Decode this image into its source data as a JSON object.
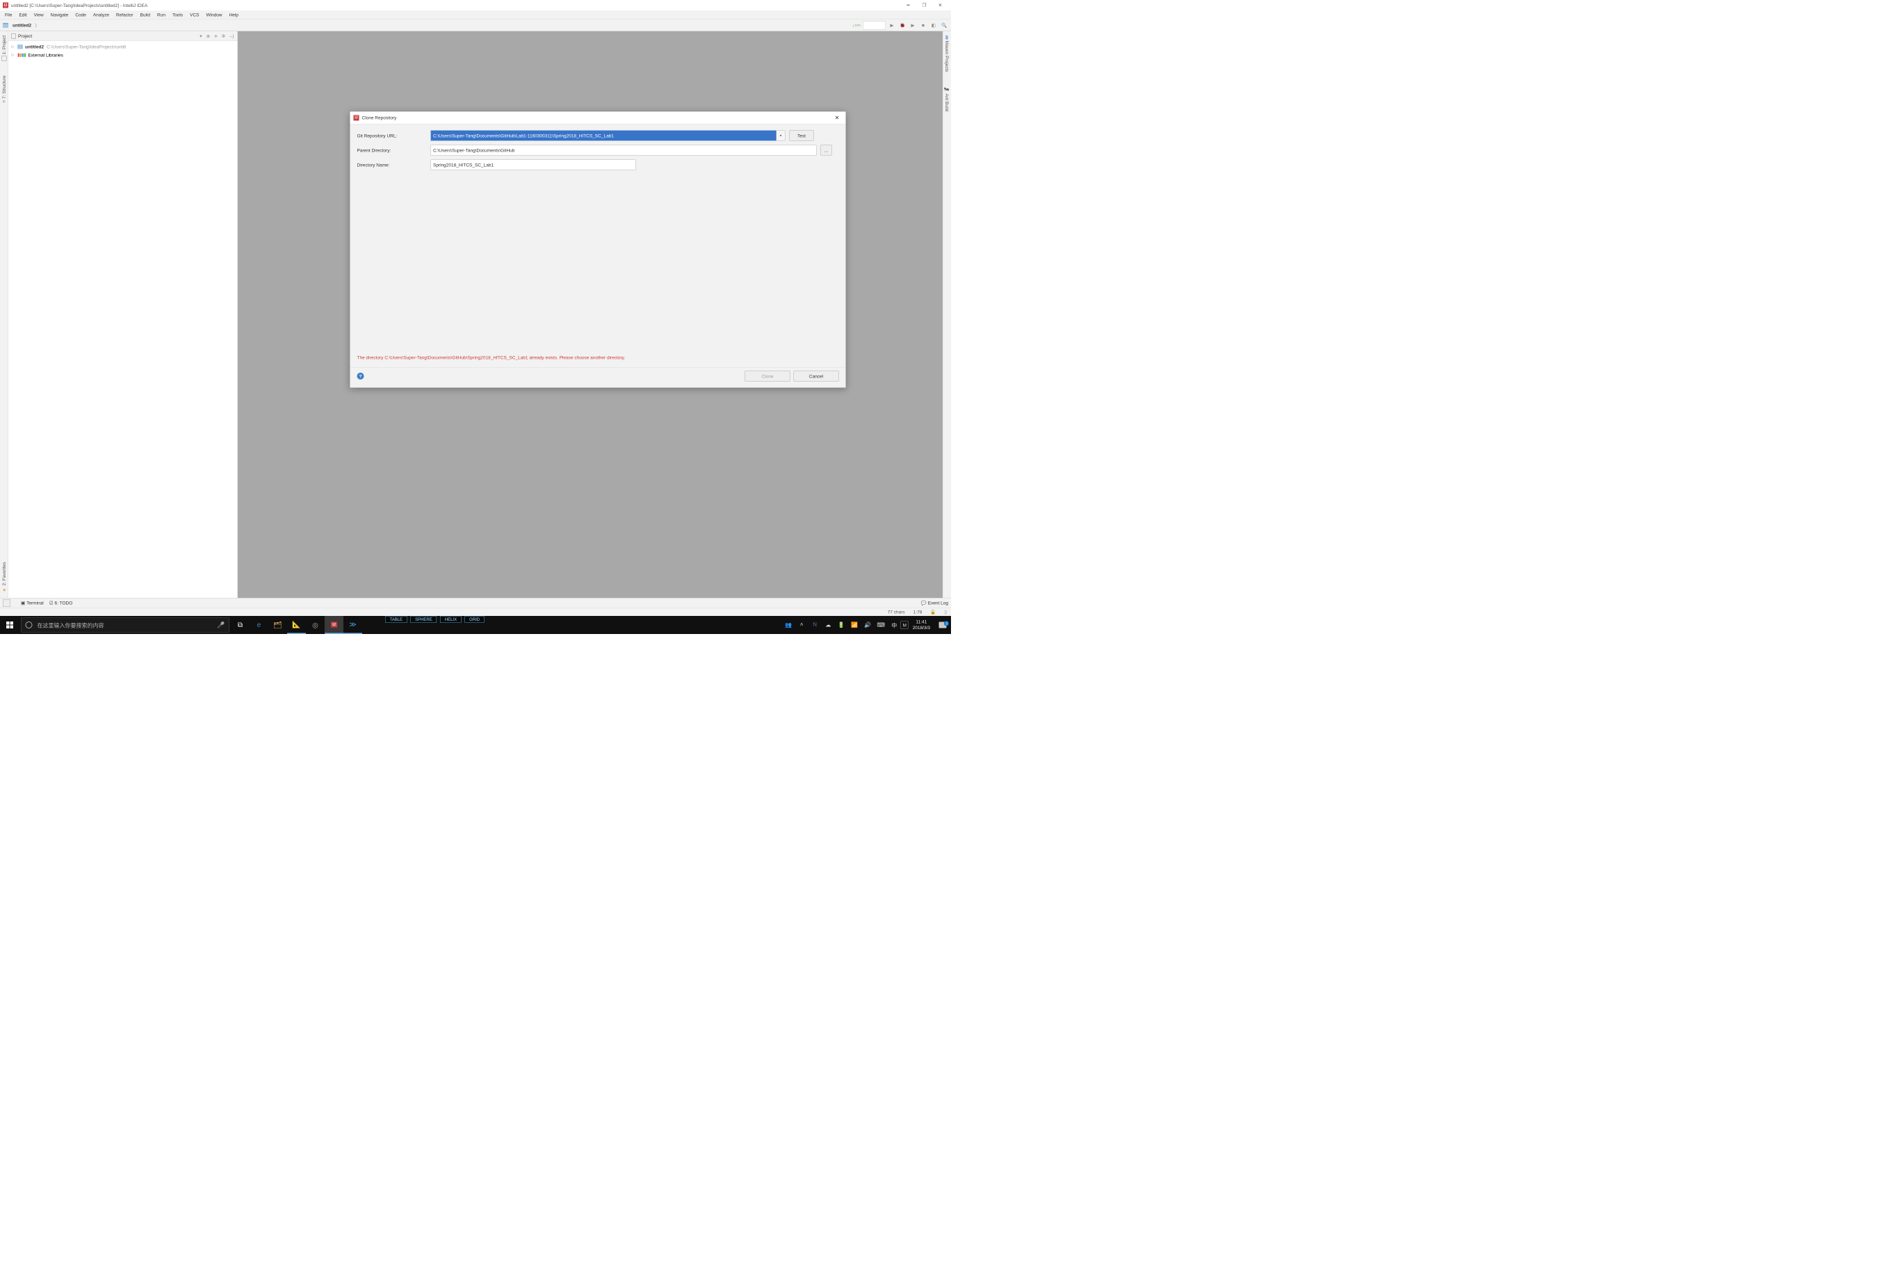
{
  "titlebar": {
    "title": "untitled2 [C:\\Users\\Super-Tang\\IdeaProjects\\untitled2] - IntelliJ IDEA"
  },
  "menubar": {
    "items": [
      "File",
      "Edit",
      "View",
      "Navigate",
      "Code",
      "Analyze",
      "Refactor",
      "Build",
      "Run",
      "Tools",
      "VCS",
      "Window",
      "Help"
    ]
  },
  "breadcrumb": {
    "root": "untitled2"
  },
  "project_panel": {
    "title": "Project",
    "tree": {
      "root_name": "untitled2",
      "root_path": "C:\\Users\\Super-Tang\\IdeaProjects\\untitl",
      "lib_name": "External Libraries"
    }
  },
  "left_tabs": {
    "project": "1: Project",
    "structure": "7: Structure",
    "favorites": "2: Favorites"
  },
  "right_tabs": {
    "maven": "Maven Projects",
    "ant": "Ant Build"
  },
  "dialog": {
    "title": "Clone Repository",
    "url_label": "Git Repository URL:",
    "url_value": "C:\\Users\\Super-Tang\\Documents\\GitHub\\Lab1-1160300311\\Spring2018_HITCS_SC_Lab1",
    "test_btn": "Test",
    "parent_label": "Parent Directory:",
    "parent_value": "C:\\Users\\Super-Tang\\Documents\\GitHub",
    "browse_btn": "...",
    "dirname_label": "Directory Name:",
    "dirname_value": "Spring2018_HITCS_SC_Lab1",
    "error": "The directory C:\\Users\\Super-Tang\\Documents\\GitHub\\Spring2018_HITCS_SC_Lab1 already exists. Please choose another directory.",
    "clone_btn": "Clone",
    "cancel_btn": "Cancel"
  },
  "bottom_bar": {
    "terminal": "Terminal",
    "todo": "6: TODO",
    "event_log": "Event Log"
  },
  "status_bar": {
    "chars": "77 chars",
    "linecol": "1:78"
  },
  "taskbar": {
    "search_placeholder": "在这里输入你要搜索的内容",
    "cmds": [
      "TABLE",
      "SPHERE",
      "HELIX",
      "GRID"
    ],
    "ime1": "中",
    "ime2": "M",
    "time": "11:41",
    "date": "2018/3/3",
    "notif_count": "3"
  }
}
